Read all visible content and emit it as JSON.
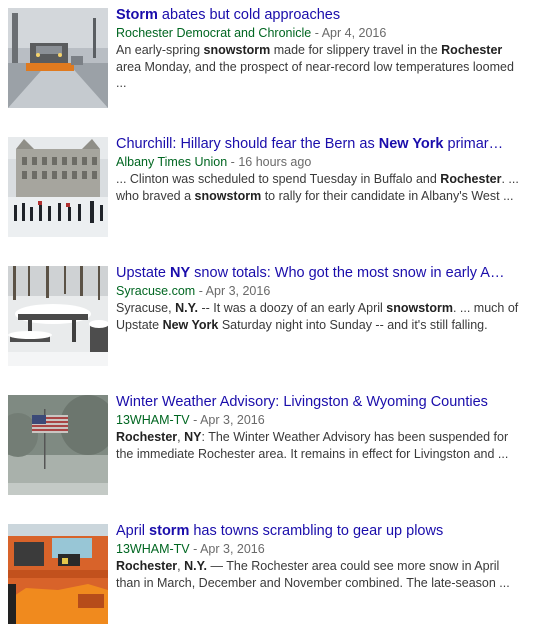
{
  "results": [
    {
      "title": [
        {
          "t": "Storm",
          "b": true
        },
        {
          "t": " abates but cold approaches",
          "b": false
        }
      ],
      "source": "Rochester Democrat and Chronicle",
      "date": "Apr 4, 2016",
      "snippet": [
        {
          "t": "An early-spring ",
          "b": false
        },
        {
          "t": "snowstorm",
          "b": true
        },
        {
          "t": " made for slippery travel in the ",
          "b": false
        },
        {
          "t": "Rochester",
          "b": true
        },
        {
          "t": " area Monday, and the prospect of near-record low temperatures loomed ...",
          "b": false
        }
      ]
    },
    {
      "title": [
        {
          "t": "Churchill: Hillary should fear the Bern as ",
          "b": false
        },
        {
          "t": "New York",
          "b": true
        },
        {
          "t": " primar…",
          "b": false
        }
      ],
      "source": "Albany Times Union",
      "date": "16 hours ago",
      "snippet": [
        {
          "t": "... Clinton was scheduled to spend Tuesday in Buffalo and ",
          "b": false
        },
        {
          "t": "Rochester",
          "b": true
        },
        {
          "t": ". ... who braved a ",
          "b": false
        },
        {
          "t": "snowstorm",
          "b": true
        },
        {
          "t": " to rally for their candidate in Albany's West ...",
          "b": false
        }
      ]
    },
    {
      "title": [
        {
          "t": "Upstate ",
          "b": false
        },
        {
          "t": "NY",
          "b": true
        },
        {
          "t": " snow totals: Who got the most snow in early A…",
          "b": false
        }
      ],
      "source": "Syracuse.com",
      "date": "Apr 3, 2016",
      "snippet": [
        {
          "t": "Syracuse, ",
          "b": false
        },
        {
          "t": "N.Y.",
          "b": true
        },
        {
          "t": " -- It was a doozy of an early April ",
          "b": false
        },
        {
          "t": "snowstorm",
          "b": true
        },
        {
          "t": ". ... much of Upstate ",
          "b": false
        },
        {
          "t": "New York",
          "b": true
        },
        {
          "t": " Saturday night into Sunday -- and it's still falling.",
          "b": false
        }
      ]
    },
    {
      "title": [
        {
          "t": "Winter Weather Advisory: Livingston & Wyoming Counties",
          "b": false
        }
      ],
      "source": "13WHAM-TV",
      "date": "Apr 3, 2016",
      "snippet": [
        {
          "t": "Rochester",
          "b": true
        },
        {
          "t": ", ",
          "b": false
        },
        {
          "t": "NY",
          "b": true
        },
        {
          "t": ": The Winter Weather Advisory has been suspended for the immediate Rochester area. It remains in effect for Livingston and ...",
          "b": false
        }
      ]
    },
    {
      "title": [
        {
          "t": "April ",
          "b": false
        },
        {
          "t": "storm",
          "b": true
        },
        {
          "t": " has towns scrambling to gear up plows",
          "b": false
        }
      ],
      "source": "13WHAM-TV",
      "date": "Apr 3, 2016",
      "snippet": [
        {
          "t": "Rochester",
          "b": true
        },
        {
          "t": ", ",
          "b": false
        },
        {
          "t": "N.Y.",
          "b": true
        },
        {
          "t": " — The Rochester area could see more snow in April than in March, December and November combined. The late-season ...",
          "b": false
        }
      ]
    }
  ],
  "separator": "-",
  "thumbnails": [
    {
      "icon": "snowplow-street-thumbnail"
    },
    {
      "icon": "capitol-rally-thumbnail"
    },
    {
      "icon": "snowy-picnic-table-thumbnail"
    },
    {
      "icon": "flag-in-snow-thumbnail"
    },
    {
      "icon": "orange-plow-truck-thumbnail"
    }
  ],
  "colors": {
    "title": "#1a0dab",
    "source": "#006621",
    "meta": "#6a6a6a",
    "snippet": "#3a3a3a"
  }
}
